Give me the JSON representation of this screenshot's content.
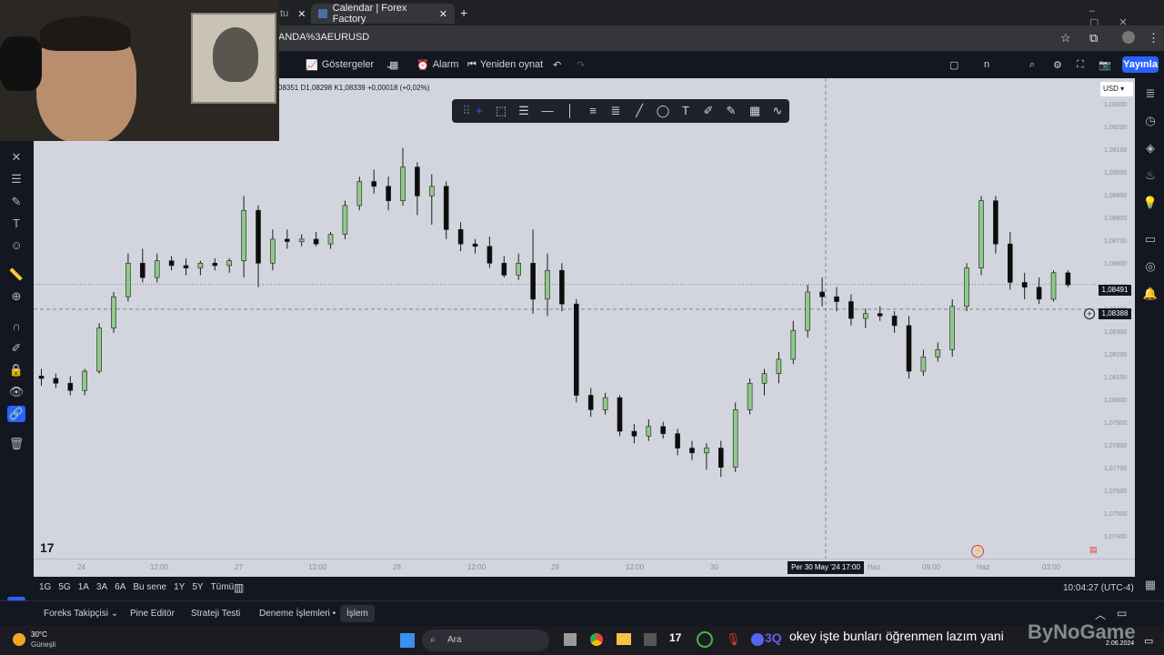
{
  "browser": {
    "tab1_label": "tu",
    "tab2_label": "Calendar | Forex Factory",
    "url": "ANDA%3AEURUSD"
  },
  "toolbar": {
    "indicators_label": "Göstergeler",
    "alarm_label": "Alarm",
    "replay_label": "Yeniden oynat",
    "n_label": "n",
    "publish_label": "Yayınla"
  },
  "ohlc_text": "08351 D1,08298 K1,08339 +0,00018 (+0,02%)",
  "price_axis": {
    "currency": "USD",
    "ticks": [
      "1,09300",
      "1,09200",
      "1,09100",
      "1,09000",
      "1,08900",
      "1,08800",
      "1,08700",
      "1,08600",
      "1,08500",
      "1,08400",
      "1,08300",
      "1,08200",
      "1,08100",
      "1,08000",
      "1,07900",
      "1,07800",
      "1,07700",
      "1,07600",
      "1,07500",
      "1,07400"
    ],
    "current_price": "1,08491",
    "crosshair_price": "1,08388"
  },
  "time_axis": {
    "labels": [
      "24",
      "12:00",
      "27",
      "12:00",
      "28",
      "12:00",
      "29",
      "12:00",
      "30",
      "Haz",
      "09:00",
      "Haz",
      "03:00"
    ],
    "crosshair_label": "Per 30 May '24   17:00"
  },
  "bottom_bar": {
    "ranges": [
      "1G",
      "5G",
      "1A",
      "3A",
      "6A",
      "Bu sene",
      "1Y",
      "5Y",
      "Tümü"
    ],
    "clock": "10:04:27 (UTC-4)"
  },
  "panel_tabs": [
    "Foreks Takipçisi",
    "Pine Editör",
    "Strateji Testi",
    "Deneme İşlemleri",
    "İşlem"
  ],
  "taskbar": {
    "weather_temp": "30°C",
    "weather_desc": "Güneşli",
    "search_label": "Ara",
    "subtitle": "okey işte bunları öğrenmen lazım yani",
    "channel_badge": "3Q",
    "watermark": "ByNoGame",
    "date": "2.06.2024"
  },
  "chart_data": {
    "type": "candlestick",
    "symbol": "EURUSD",
    "timeframe": "1h",
    "ylim": [
      1.0735,
      1.0935
    ],
    "candles": [
      [
        1.0811,
        1.0814,
        1.0807,
        1.081
      ],
      [
        1.081,
        1.0812,
        1.0806,
        1.0808
      ],
      [
        1.0808,
        1.0811,
        1.0803,
        1.0805
      ],
      [
        1.0805,
        1.0814,
        1.0803,
        1.0813
      ],
      [
        1.0813,
        1.0833,
        1.0812,
        1.0831
      ],
      [
        1.0831,
        1.0846,
        1.0829,
        1.0844
      ],
      [
        1.0844,
        1.0862,
        1.0842,
        1.0858
      ],
      [
        1.0858,
        1.0864,
        1.085,
        1.0852
      ],
      [
        1.0852,
        1.0862,
        1.085,
        1.0859
      ],
      [
        1.0859,
        1.0861,
        1.0855,
        1.0857
      ],
      [
        1.0857,
        1.086,
        1.0853,
        1.0856
      ],
      [
        1.0856,
        1.0859,
        1.0853,
        1.0858
      ],
      [
        1.0858,
        1.086,
        1.0855,
        1.0857
      ],
      [
        1.0857,
        1.086,
        1.0854,
        1.0859
      ],
      [
        1.0859,
        1.0886,
        1.0852,
        1.088
      ],
      [
        1.088,
        1.0882,
        1.0848,
        1.0858
      ],
      [
        1.0858,
        1.0872,
        1.0855,
        1.0868
      ],
      [
        1.0868,
        1.0872,
        1.0864,
        1.0867
      ],
      [
        1.0867,
        1.087,
        1.0865,
        1.0868
      ],
      [
        1.0868,
        1.0871,
        1.0865,
        1.0866
      ],
      [
        1.0866,
        1.0871,
        1.0864,
        1.087
      ],
      [
        1.087,
        1.0884,
        1.0868,
        1.0882
      ],
      [
        1.0882,
        1.0894,
        1.088,
        1.0892
      ],
      [
        1.0892,
        1.0897,
        1.0887,
        1.089
      ],
      [
        1.089,
        1.0894,
        1.088,
        1.0884
      ],
      [
        1.0884,
        1.0906,
        1.0882,
        1.0898
      ],
      [
        1.0898,
        1.09,
        1.0878,
        1.0886
      ],
      [
        1.0886,
        1.0895,
        1.0874,
        1.089
      ],
      [
        1.089,
        1.0892,
        1.0868,
        1.0872
      ],
      [
        1.0872,
        1.0875,
        1.0863,
        1.0866
      ],
      [
        1.0866,
        1.0868,
        1.0862,
        1.0865
      ],
      [
        1.0865,
        1.0869,
        1.0856,
        1.0858
      ],
      [
        1.0858,
        1.0861,
        1.0852,
        1.0853
      ],
      [
        1.0853,
        1.0862,
        1.0851,
        1.0858
      ],
      [
        1.0858,
        1.0872,
        1.0837,
        1.0843
      ],
      [
        1.0843,
        1.0862,
        1.0836,
        1.0855
      ],
      [
        1.0855,
        1.0858,
        1.0838,
        1.0841
      ],
      [
        1.0841,
        1.0843,
        1.08,
        1.0803
      ],
      [
        1.0803,
        1.0806,
        1.0794,
        1.0797
      ],
      [
        1.0797,
        1.0804,
        1.0795,
        1.0802
      ],
      [
        1.0802,
        1.0803,
        1.0786,
        1.0788
      ],
      [
        1.0788,
        1.0791,
        1.0783,
        1.0786
      ],
      [
        1.0786,
        1.0793,
        1.0784,
        1.079
      ],
      [
        1.079,
        1.0792,
        1.0785,
        1.0787
      ],
      [
        1.0787,
        1.0789,
        1.0778,
        1.0781
      ],
      [
        1.0781,
        1.0784,
        1.0776,
        1.0779
      ],
      [
        1.0779,
        1.0783,
        1.0772,
        1.0781
      ],
      [
        1.0781,
        1.0784,
        1.0769,
        1.0773
      ],
      [
        1.0773,
        1.08,
        1.0771,
        1.0797
      ],
      [
        1.0797,
        1.081,
        1.0795,
        1.0808
      ],
      [
        1.0808,
        1.0814,
        1.0803,
        1.0812
      ],
      [
        1.0812,
        1.0821,
        1.0808,
        1.0818
      ],
      [
        1.0818,
        1.0834,
        1.0816,
        1.083
      ],
      [
        1.083,
        1.0849,
        1.0827,
        1.0846
      ],
      [
        1.0846,
        1.0852,
        1.084,
        1.0844
      ],
      [
        1.0844,
        1.0848,
        1.0838,
        1.0842
      ],
      [
        1.0842,
        1.0845,
        1.0832,
        1.0835
      ],
      [
        1.0835,
        1.0839,
        1.0831,
        1.0837
      ],
      [
        1.0837,
        1.084,
        1.0834,
        1.0836
      ],
      [
        1.0836,
        1.0838,
        1.0829,
        1.0832
      ],
      [
        1.0832,
        1.0836,
        1.081,
        1.0813
      ],
      [
        1.0813,
        1.0822,
        1.0811,
        1.0819
      ],
      [
        1.0819,
        1.0825,
        1.0817,
        1.0822
      ],
      [
        1.0822,
        1.0843,
        1.0819,
        1.084
      ],
      [
        1.084,
        1.0858,
        1.0838,
        1.0856
      ],
      [
        1.0856,
        1.0886,
        1.0853,
        1.0884
      ],
      [
        1.0884,
        1.0886,
        1.0862,
        1.0866
      ],
      [
        1.0866,
        1.0871,
        1.0847,
        1.085
      ],
      [
        1.085,
        1.0854,
        1.0843,
        1.0848
      ],
      [
        1.0848,
        1.0852,
        1.0841,
        1.0843
      ],
      [
        1.0843,
        1.0855,
        1.0842,
        1.0854
      ],
      [
        1.0854,
        1.0855,
        1.0848,
        1.0849
      ]
    ]
  }
}
